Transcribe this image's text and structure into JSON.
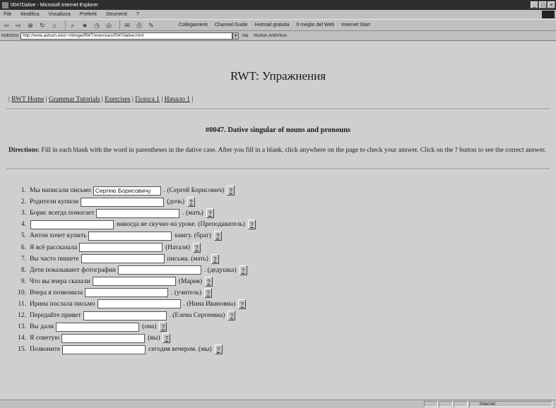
{
  "window": {
    "title": "0047Dative - Microsoft Internet Explorer",
    "controls": [
      "_",
      "□",
      "×"
    ]
  },
  "menu": [
    "File",
    "Modifica",
    "Visualizza",
    "Preferiti",
    "Strumenti",
    "?"
  ],
  "links_toolbar": [
    "Collegamenti",
    "Channel Guide",
    "Hotmail gratuita",
    "Il meglio del Web",
    "Internet Start"
  ],
  "address": {
    "label": "Indirizzo",
    "url": "http://www.auburn.edu/~mitrege/RWT/exercises/0047dative.html",
    "go_label": "Vai",
    "norton": "Norton AntiVirus"
  },
  "page": {
    "title": "RWT: Упражнения",
    "nav": [
      "RWT Home",
      "Grammar Tutorials",
      "Exercises",
      "Голоса 1",
      "Начало 1"
    ],
    "heading": "#0047. Dative singular of nouns and pronouns",
    "directions_label": "Directions",
    "directions_text": ": Fill in each blank with the word in parentheses in the dative case. After you fill in a blank, click anywhere on the page to check your answer. Click on the ? button to see the correct answer.",
    "hint_label": "?",
    "items": [
      {
        "num": "1.",
        "before": "Мы написали письмо",
        "value": "Сергею Борисовичу",
        "after": ". (Сергей Борисович)",
        "width": 96
      },
      {
        "num": "2.",
        "before": "Родители купили",
        "value": "",
        "after": "(дочь)",
        "width": 118
      },
      {
        "num": "3.",
        "before": "Борис всегда помогает",
        "value": "",
        "after": ". (мать)",
        "width": 118
      },
      {
        "num": "4.",
        "before": "",
        "value": "",
        "after": "никогда не скучно на уроке. (Преподаватель)",
        "width": 118
      },
      {
        "num": "5.",
        "before": "Антон хочет купить",
        "value": "",
        "after": "книгу. (брат)",
        "width": 118
      },
      {
        "num": "6.",
        "before": "Я всё рассказала",
        "value": "",
        "after": "(Наталя)",
        "width": 118
      },
      {
        "num": "7.",
        "before": "Вы часто пишете",
        "value": "",
        "after": "письма. (мать)",
        "width": 118
      },
      {
        "num": "8.",
        "before": "Дети показывают фотографии",
        "value": "",
        "after": ". (дедушка)",
        "width": 118
      },
      {
        "num": "9.",
        "before": "Что вы вчера сказали",
        "value": "",
        "after": "(Мария)",
        "width": 118
      },
      {
        "num": "10.",
        "before": "Вчера я позвонила",
        "value": "",
        "after": ". (учитель)",
        "width": 118
      },
      {
        "num": "11.",
        "before": "Ирина послала письмо",
        "value": "",
        "after": ". (Нина Ивановна)",
        "width": 118
      },
      {
        "num": "12.",
        "before": "Передайте привет",
        "value": "",
        "after": ". (Елена Сергеевна)",
        "width": 118
      },
      {
        "num": "13.",
        "before": "Вы дали",
        "value": "",
        "after": "(она)",
        "width": 118
      },
      {
        "num": "14.",
        "before": "Я советую",
        "value": "",
        "after": "(вы)",
        "width": 118
      },
      {
        "num": "15.",
        "before": "Позвоните",
        "value": "",
        "after": "сегодня вечером. (мы)",
        "width": 118
      }
    ]
  },
  "status": {
    "left": "",
    "zone": "Internet"
  }
}
